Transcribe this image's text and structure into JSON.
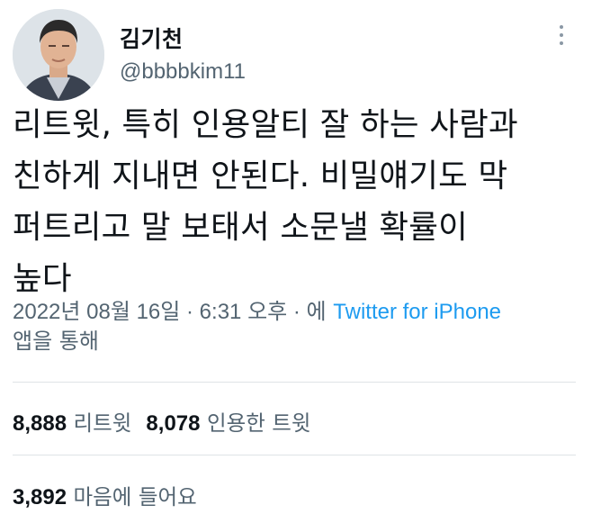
{
  "author": {
    "display_name": "김기천",
    "handle": "@bbbbkim11"
  },
  "tweet": {
    "lines": [
      "리트윗, 특히 인용알티 잘 하는 사람과",
      "친하게 지내면 안된다. 비밀얘기도 막",
      "퍼트리고 말 보태서 소문낼 확률이",
      "높다"
    ],
    "timestamp": "2022년 08월 16일 · 6:31 오후 · 에",
    "source_link": "Twitter for iPhone",
    "source_suffix": "앱을 통해"
  },
  "stats": {
    "retweets_count": "8,888",
    "retweets_label": "리트윗",
    "quotes_count": "8,078",
    "quotes_label": "인용한 트윗",
    "likes_count": "3,892",
    "likes_label": "마음에 들어요"
  },
  "icons": {
    "more": "more-vertical-icon"
  }
}
